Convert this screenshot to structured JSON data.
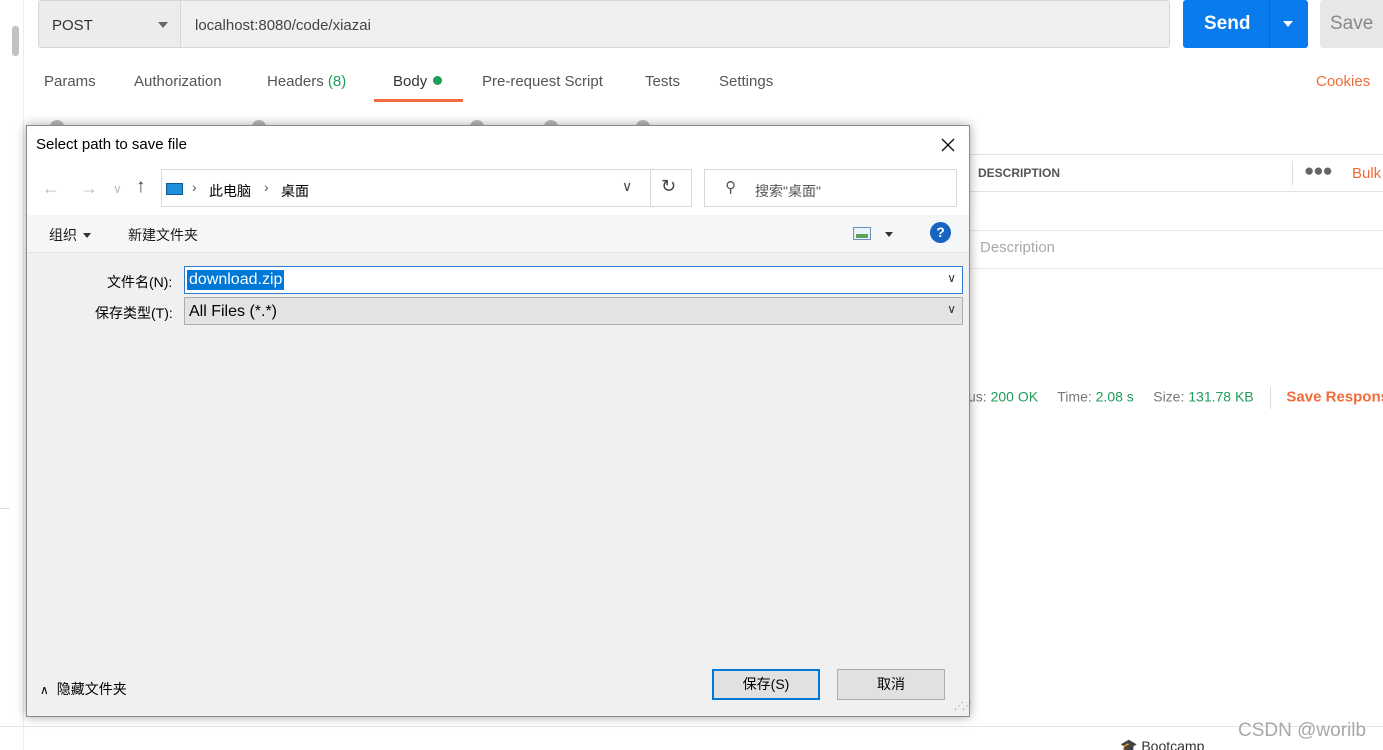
{
  "request": {
    "method": "POST",
    "url": "localhost:8080/code/xiazai",
    "send_label": "Send",
    "save_label": "Save"
  },
  "tabs": [
    {
      "label": "Params"
    },
    {
      "label": "Authorization"
    },
    {
      "label": "Headers",
      "count": "(8)"
    },
    {
      "label": "Body"
    },
    {
      "label": "Pre-request Script"
    },
    {
      "label": "Tests"
    },
    {
      "label": "Settings"
    }
  ],
  "cookies_label": "Cookies",
  "params_table": {
    "description_header": "DESCRIPTION",
    "bulk_label": "Bulk",
    "description_placeholder": "Description"
  },
  "response_status": {
    "status_label": "us:",
    "status_value": "200 OK",
    "time_label": "Time:",
    "time_value": "2.08 s",
    "size_label": "Size:",
    "size_value": "131.78 KB",
    "save_response": "Save Respons"
  },
  "footer": {
    "bootcamp": "Bootcamp",
    "watermark": "CSDN @worilb"
  },
  "dialog": {
    "title": "Select path to save file",
    "address": {
      "segments": [
        "此电脑",
        "桌面"
      ]
    },
    "search_placeholder": "搜索\"桌面\"",
    "organize_label": "组织",
    "new_folder_label": "新建文件夹",
    "help_label": "?",
    "filename_label": "文件名(N):",
    "filename_value": "download.zip",
    "filetype_label": "保存类型(T):",
    "filetype_value": "All Files (*.*)",
    "hide_folders_label": "隐藏文件夹",
    "save_button": "保存(S)",
    "cancel_button": "取消"
  },
  "colors": {
    "accent": "#f26b3a",
    "send": "#097bed",
    "success": "#1e9c5a",
    "selection": "#0078d7"
  }
}
